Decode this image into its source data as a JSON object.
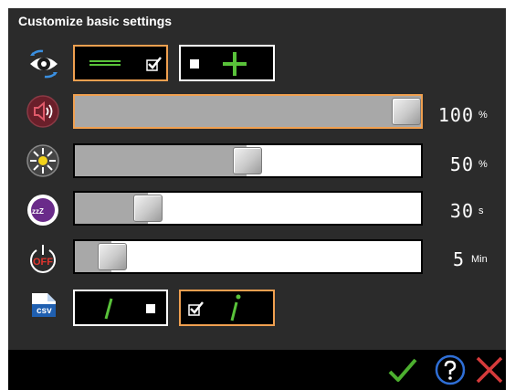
{
  "dialog": {
    "title": "Customize basic settings"
  },
  "rows": {
    "display": {
      "icon": "eye-rotate-icon",
      "options": [
        {
          "icon": "minus-line-icon",
          "state": "checked"
        },
        {
          "icon": "plus-line-icon",
          "state": "unchecked"
        }
      ]
    },
    "volume": {
      "icon": "speaker-icon",
      "value": "100",
      "unit": "%",
      "level": 1.0
    },
    "brightness": {
      "icon": "sun-icon",
      "value": "50",
      "unit": "%",
      "level": 0.5
    },
    "sleep": {
      "icon": "moon-zzz-icon",
      "value": "30",
      "unit": "s",
      "level": 0.2
    },
    "auto_off": {
      "icon": "power-off-icon",
      "value": "5",
      "unit": "Min",
      "level": 0.05
    },
    "csv": {
      "icon": "csv-file-icon",
      "badge": "csv",
      "options": [
        {
          "icon": "slash-icon",
          "state": "unchecked"
        },
        {
          "icon": "info-i-icon",
          "state": "checked"
        }
      ]
    }
  },
  "footer": {
    "confirm_icon": "check-icon",
    "help_icon": "question-icon",
    "cancel_icon": "close-icon"
  },
  "colors": {
    "accent": "#f0a050",
    "green": "#59c23a",
    "panel": "#2b2b2b",
    "cancel": "#d63b3b",
    "help": "#2f6fd6"
  }
}
